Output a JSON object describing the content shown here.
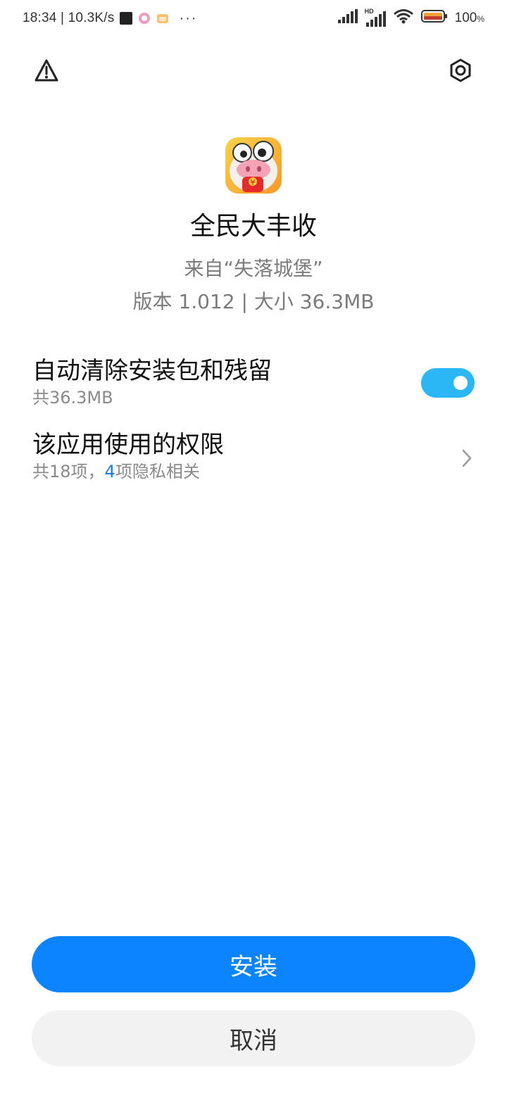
{
  "status_bar": {
    "time_speed": "18:34 | 10.3K/s",
    "more": "···",
    "network_badge": "HD",
    "battery_percent": "100",
    "battery_percent_sign": "%"
  },
  "top_actions": {
    "warning_icon": "warning-triangle-icon",
    "settings_icon": "settings-hexagon-icon"
  },
  "app": {
    "name": "全民大丰收",
    "source": "来自“失落城堡”",
    "version_size": "版本 1.012 | 大小 36.3MB"
  },
  "options": {
    "auto_clean": {
      "title": "自动清除安装包和残留",
      "subtitle": "共36.3MB",
      "enabled": true
    },
    "permissions": {
      "title": "该应用使用的权限",
      "sub_prefix": "共18项，",
      "sub_count": "4",
      "sub_suffix": "项隐私相关"
    }
  },
  "buttons": {
    "install": "安装",
    "cancel": "取消"
  },
  "colors": {
    "primary": "#0d84ff",
    "toggle_on": "#2bb6f5",
    "accent_text": "#1a7cf0",
    "secondary_bg": "#f2f2f2"
  }
}
